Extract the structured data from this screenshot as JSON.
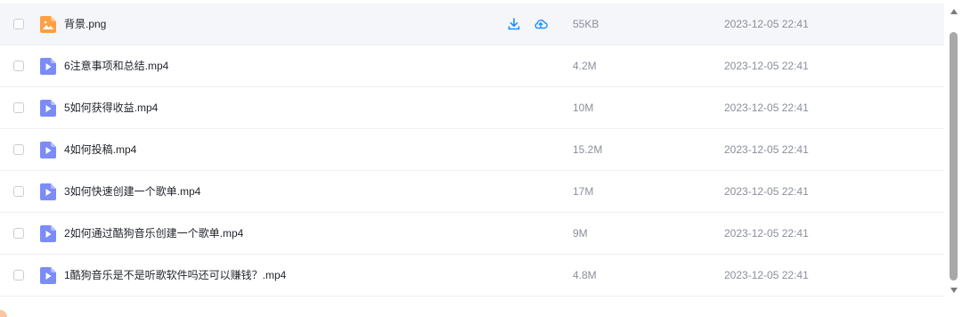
{
  "colors": {
    "accent": "#1890ff",
    "video_icon": "#7b8cf7",
    "image_icon": "#ff9f43"
  },
  "files": [
    {
      "name": "背景.png",
      "size": "55KB",
      "date": "2023-12-05 22:41",
      "type": "image",
      "icon": "image-file-icon"
    },
    {
      "name": "6注意事项和总结.mp4",
      "size": "4.2M",
      "date": "2023-12-05 22:41",
      "type": "video",
      "icon": "video-file-icon"
    },
    {
      "name": "5如何获得收益.mp4",
      "size": "10M",
      "date": "2023-12-05 22:41",
      "type": "video",
      "icon": "video-file-icon"
    },
    {
      "name": "4如何投稿.mp4",
      "size": "15.2M",
      "date": "2023-12-05 22:41",
      "type": "video",
      "icon": "video-file-icon"
    },
    {
      "name": "3如何快速创建一个歌单.mp4",
      "size": "17M",
      "date": "2023-12-05 22:41",
      "type": "video",
      "icon": "video-file-icon"
    },
    {
      "name": "2如何通过酷狗音乐创建一个歌单.mp4",
      "size": "9M",
      "date": "2023-12-05 22:41",
      "type": "video",
      "icon": "video-file-icon"
    },
    {
      "name": "1酷狗音乐是不是听歌软件吗还可以赚钱？.mp4",
      "size": "4.8M",
      "date": "2023-12-05 22:41",
      "type": "video",
      "icon": "video-file-icon"
    }
  ]
}
